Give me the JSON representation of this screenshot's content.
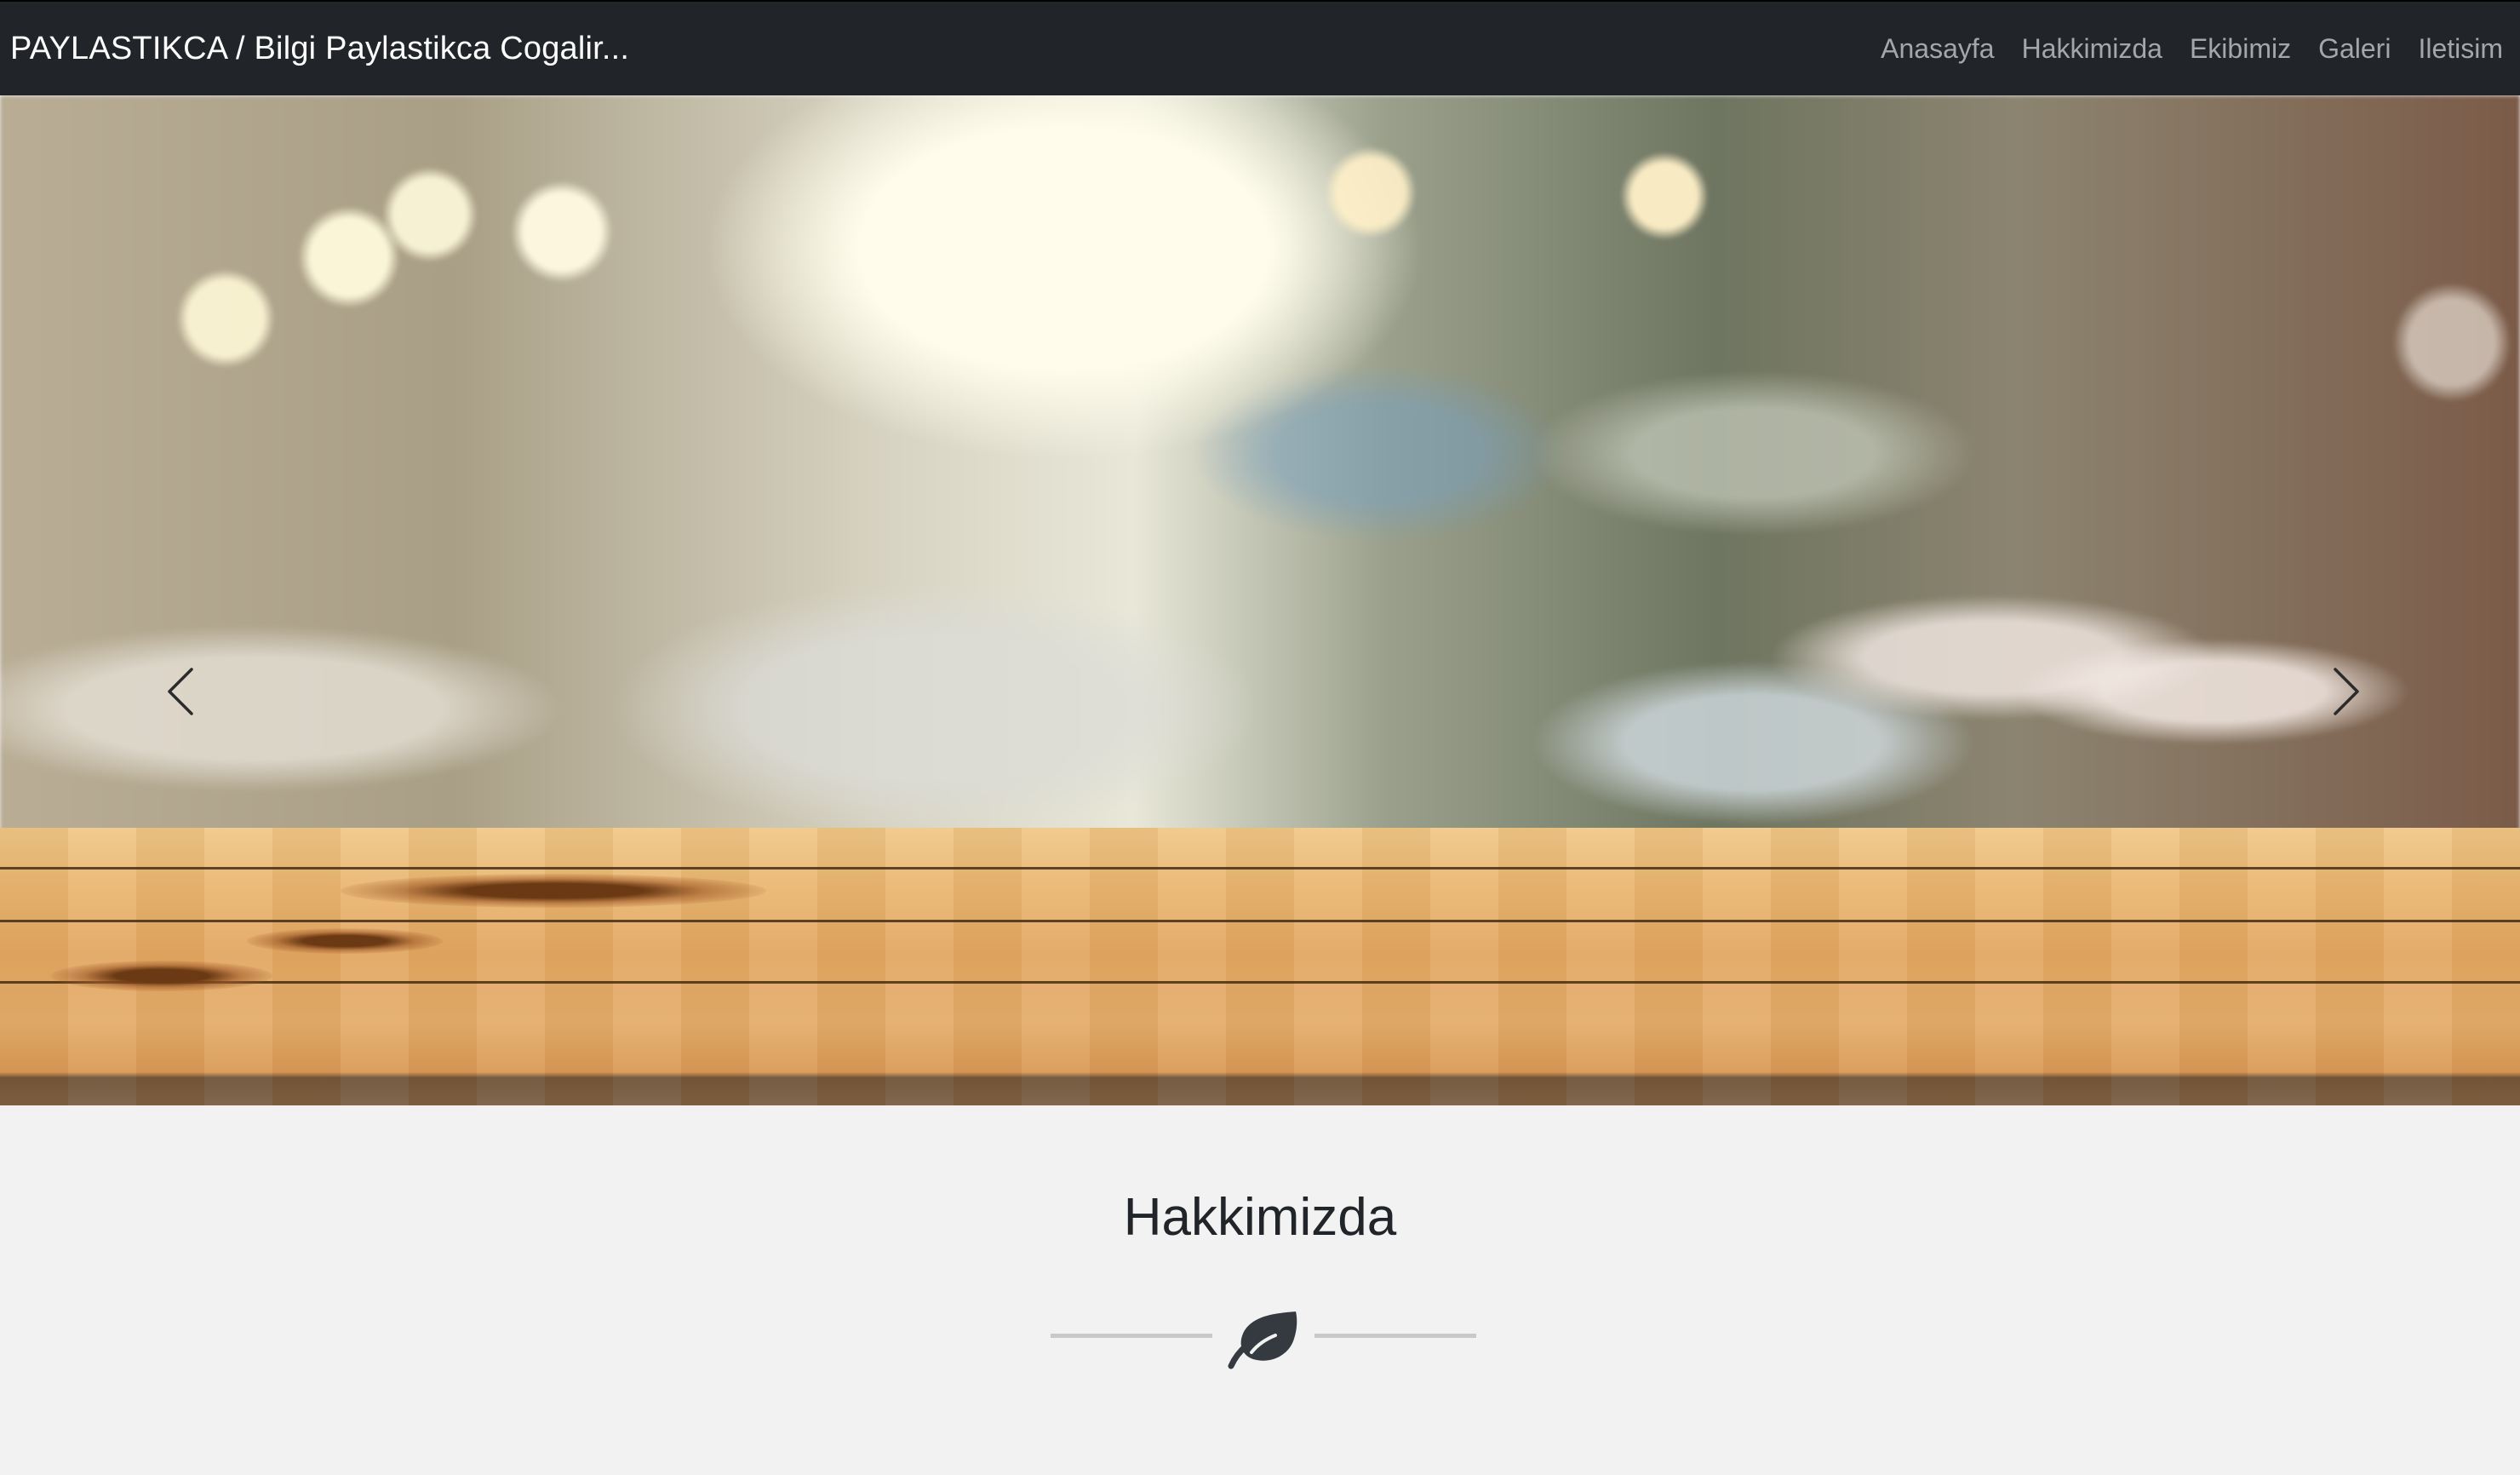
{
  "navbar": {
    "brand": "PAYLASTIKCA / Bilgi Paylastikca Cogalir...",
    "links": [
      {
        "label": "Anasayfa"
      },
      {
        "label": "Hakkimizda"
      },
      {
        "label": "Ekibimiz"
      },
      {
        "label": "Galeri"
      },
      {
        "label": "Iletisim"
      }
    ]
  },
  "carousel": {
    "prev_icon": "chevron-left-icon",
    "next_icon": "chevron-right-icon",
    "slide_count": 3,
    "active_index": 0
  },
  "about": {
    "title": "Hakkimizda",
    "divider_icon": "leaf-icon"
  },
  "colors": {
    "navbar_bg": "#212529",
    "brand_text": "#ffffff",
    "nav_link": "#a4a7aa",
    "section_bg": "#f2f2f2",
    "title_text": "#212529",
    "divider_line": "#c8c9ca",
    "leaf": "#343a40"
  }
}
